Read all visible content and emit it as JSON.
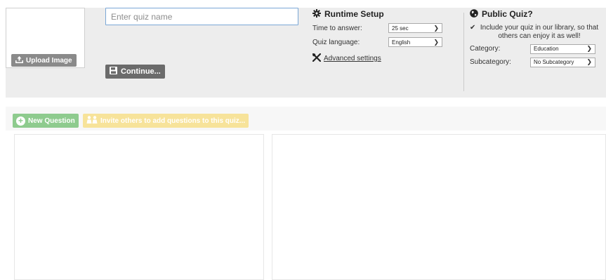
{
  "image_upload": {
    "button_label": "Upload Image",
    "icon": "upload-icon"
  },
  "quiz_name": {
    "value": "",
    "placeholder": "Enter quiz name"
  },
  "continue_button": {
    "label": "Continue...",
    "icon": "save-icon"
  },
  "runtime": {
    "title": "Runtime Setup",
    "icon": "gear-icon",
    "time_label": "Time to answer:",
    "time_value": "25 sec",
    "language_label": "Quiz language:",
    "language_value": "English",
    "advanced_label": "Advanced settings",
    "advanced_icon": "tools-icon"
  },
  "public_quiz": {
    "title": "Public Quiz?",
    "icon": "globe-icon",
    "include_checked": true,
    "include_text": "Include your quiz in our library, so that others can enjoy it as well!",
    "category_label": "Category:",
    "category_value": "Education",
    "subcategory_label": "Subcategory:",
    "subcategory_value": "No Subcategory"
  },
  "toolbar": {
    "new_question_label": "New Question",
    "invite_label": "Invite others to add questions to this quiz..."
  },
  "colors": {
    "panel_bg": "#ededed",
    "new_question_bg": "#8ecb8e",
    "invite_bg": "#f7e39a",
    "continue_bg": "#6b6b6b",
    "upload_bg": "#8a8a8a"
  }
}
